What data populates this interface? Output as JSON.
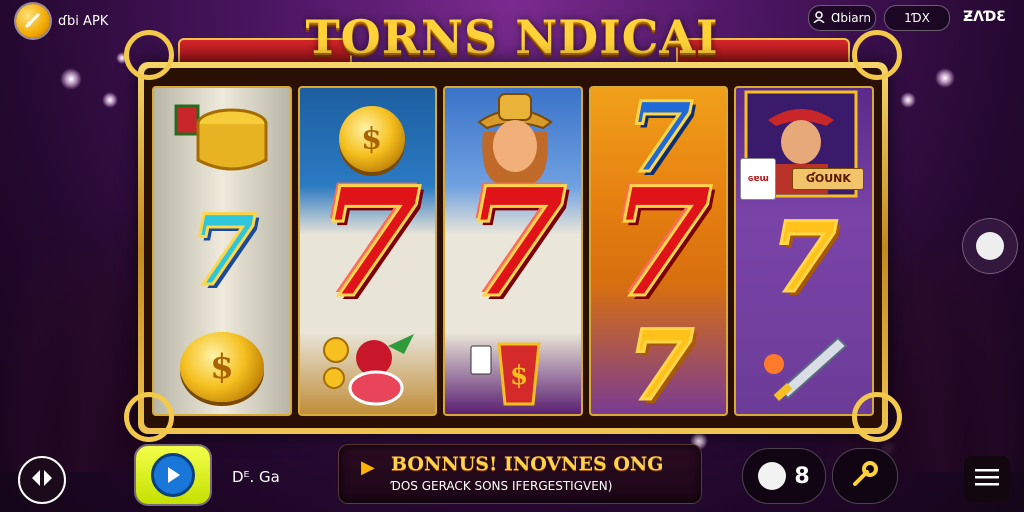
{
  "app": {
    "name": "ɗbi APK"
  },
  "top_bar": {
    "account_label": "Ɑbiarn",
    "balance_label": "1ƊX",
    "score_label": "ƵɅƊƐ"
  },
  "game": {
    "title": "TORNS NDICAI",
    "reels": [
      {
        "symbols": [
          "coin-bucket",
          "7",
          "coin-stack"
        ]
      },
      {
        "symbols": [
          "coin-fruit",
          "7",
          "fruit"
        ]
      },
      {
        "symbols": [
          "cowgirl",
          "7",
          "cup-cards"
        ]
      },
      {
        "symbols": [
          "7",
          "7",
          "7"
        ]
      },
      {
        "symbols": [
          "cowboy",
          "7",
          "sword"
        ]
      }
    ],
    "character_card_text": "ƓOUNK",
    "small_card_text": "ɢɐɯ"
  },
  "bottom_bar": {
    "bet_label": "Dᴱ. Ga",
    "bonus_title": "BONNUS! INOVNES ONG",
    "bonus_subtitle": "ƊOS GERACK SONS IFERGESTIGVEN)",
    "coin_count": "8"
  },
  "colors": {
    "accent_gold": "#ffd23a",
    "play_green": "#d8f000",
    "seven_red": "#e01318"
  }
}
